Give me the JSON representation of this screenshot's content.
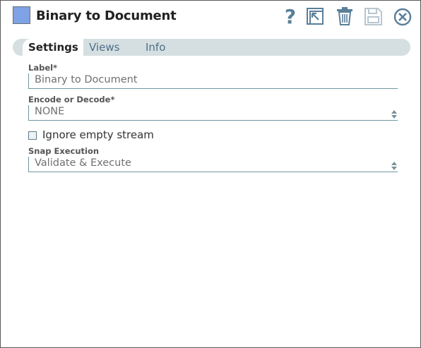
{
  "header": {
    "title": "Binary to Document",
    "swatch_color": "#7fa2e6",
    "icons": [
      "help-icon",
      "open-icon",
      "trash-icon",
      "save-icon",
      "close-icon"
    ]
  },
  "tabs": [
    {
      "label": "Settings",
      "active": true
    },
    {
      "label": "Views",
      "active": false
    },
    {
      "label": "Info",
      "active": false
    }
  ],
  "fields": {
    "label": {
      "label": "Label*",
      "value": "Binary to Document"
    },
    "encode_decode": {
      "label": "Encode or Decode*",
      "value": "NONE"
    },
    "ignore_empty": {
      "label": "Ignore empty stream",
      "checked": false
    },
    "snap_execution": {
      "label": "Snap Execution",
      "value": "Validate & Execute"
    }
  },
  "colors": {
    "accent": "#4f6f8a",
    "field_border": "#6f97a3",
    "tabbar": "#d5dfe1"
  }
}
